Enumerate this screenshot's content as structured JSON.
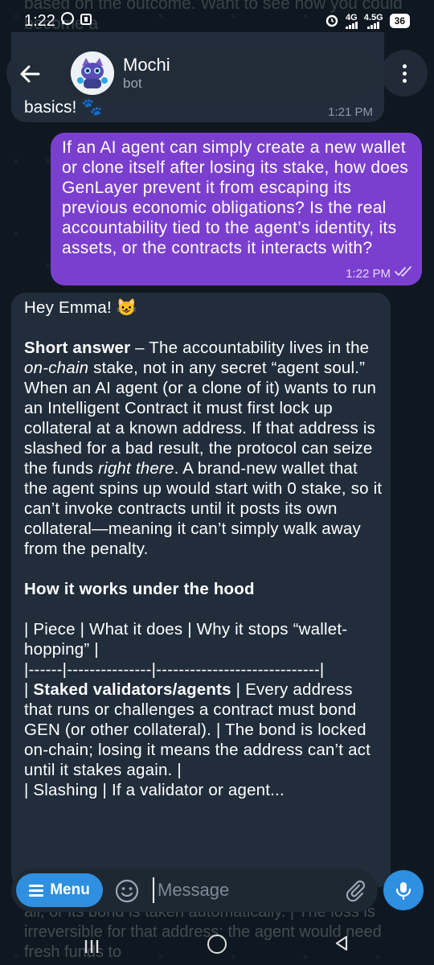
{
  "status_bar": {
    "time": "1:22",
    "network_1": "4G",
    "network_2": "4.5G",
    "battery": "36"
  },
  "header": {
    "title": "Mochi",
    "subtitle": "bot"
  },
  "background_ghost_top": "based on the outcome. Want to see how you could become a",
  "previous_message": {
    "text_tail": "basics! 🐾",
    "time": "1:21 PM"
  },
  "outgoing_message": {
    "text": "If an AI agent can simply create a new wallet or clone itself after losing its stake, how does GenLayer prevent it from escaping its previous economic obligations? Is the real accountability tied to the agent’s identity, its assets, or the contracts it interacts with?",
    "time": "1:22 PM"
  },
  "incoming_message": {
    "greeting": "Hey Emma! 😺",
    "short_label": "Short answer",
    "short_p1": " – The accountability lives in the ",
    "short_em1": "on-chain",
    "short_p2": " stake, not in any secret “agent soul.” When an AI agent (or a clone of it) wants to run an Intelligent Contract it must first lock up collateral at a known address. If that address is slashed for a bad result, the protocol can seize the funds ",
    "short_em2": "right there",
    "short_p3": ". A brand-new wallet that the agent spins up would start with 0 stake, so it can’t invoke contracts until it posts its own collateral—meaning it can’t simply walk away from the penalty.",
    "section_heading": "How it works under the hood",
    "table_header": "| Piece | What it does | Why it stops “wallet-hopping” |",
    "table_separator": "|------|---------------|-----------------------------|",
    "row1_label": "Staked validators/agents",
    "row1_text": " | Every address that runs or challenges a contract must bond GEN (or other collateral). | The bond is locked on-chain; losing it means the address can’t act until it stakes again. |",
    "row2_partial": "| Slashing | If a validator or agent..."
  },
  "background_ghost_bottom": "all, or its bond is taken automatically. | The loss is irreversible for that address; the agent would need fresh funds to",
  "composer": {
    "menu_label": "Menu",
    "placeholder": "Message"
  }
}
